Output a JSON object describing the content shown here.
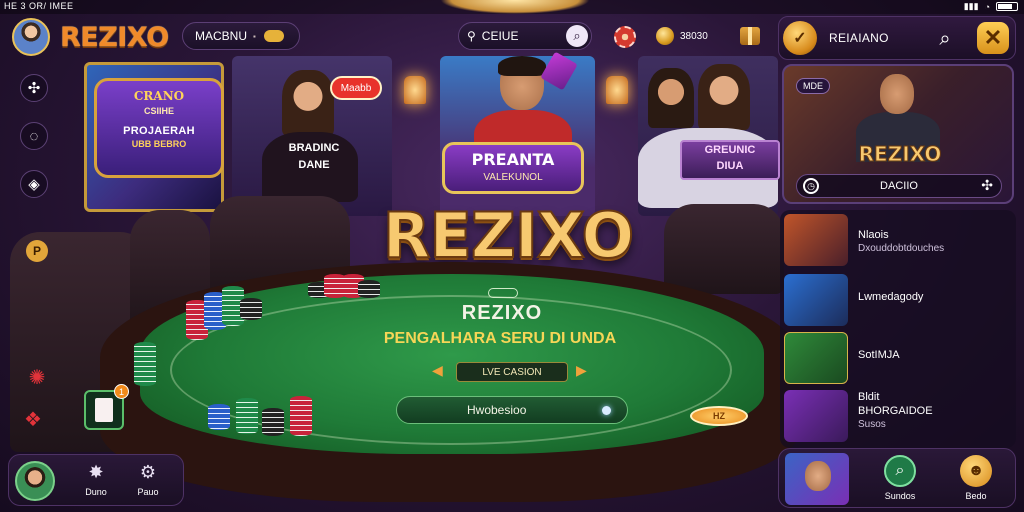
{
  "status_bar": {
    "clock": "HE 3 OR/ IMEE"
  },
  "header": {
    "brand": "REZIXO",
    "menu_pill": {
      "label": "MACBNU",
      "icon": "toggle-icon"
    },
    "search_pill": {
      "label": "CEIUE"
    },
    "currency_pill": {
      "label": "38030"
    }
  },
  "right_header": {
    "logo_glyph": "✓",
    "name": "REIAIANO"
  },
  "scene": {
    "sign_left": {
      "title": "CRANO",
      "line2": "CSIIHE",
      "line3": "PROJAERAH",
      "line4": "UBB BEBRO"
    },
    "badge_red": "Maabb",
    "sign_center_small": "BRADINC\nDANE",
    "ribbon_banner": {
      "title": "PREANTA",
      "subtitle": "VALEKUNOL"
    },
    "sign_right": "GREUNIC\nDIUA",
    "big_logo": "REZIXO"
  },
  "table": {
    "title": "REZIXO",
    "subtitle": "PENGALHARA SERU DI UNDA",
    "live_strip": "LVE CASION",
    "play_bar": "Hwobesioo",
    "token": "HZ"
  },
  "left_column": {
    "badge": "P",
    "card_notification": "1"
  },
  "bottom_nav": {
    "items": [
      {
        "label": "Duno",
        "icon": "star-badge-icon"
      },
      {
        "label": "Pauo",
        "icon": "gear-icon"
      }
    ]
  },
  "featured": {
    "tag": "MDE",
    "logo": "REZIXO",
    "bar_label": "DACIIO"
  },
  "side_list": {
    "items": [
      {
        "title": "Nlaois",
        "subtitle": "Dxouddobtdouches"
      },
      {
        "title": "Lwmedagody",
        "subtitle": ""
      },
      {
        "title": "SotIMJA",
        "subtitle": ""
      },
      {
        "title": "Bldit",
        "subtitle": "BHORGAIDOE",
        "extra": "Susos"
      }
    ]
  },
  "bottom_right": {
    "items": [
      {
        "label": "Sundos",
        "icon": "search-icon"
      },
      {
        "label": "Bedo",
        "icon": "mascot-icon"
      }
    ]
  }
}
